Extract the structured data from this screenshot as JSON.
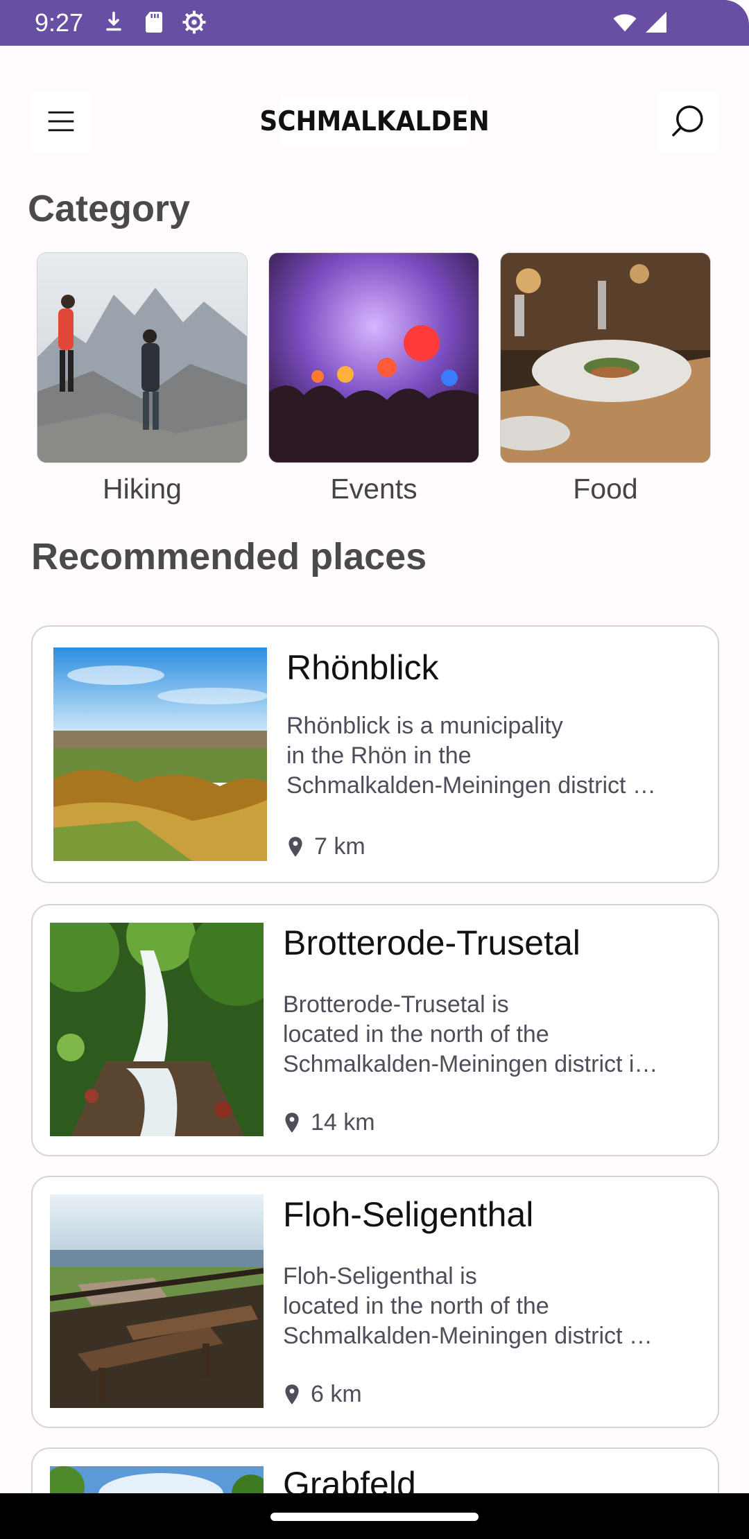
{
  "status_bar": {
    "time": "9:27",
    "icons": [
      "download-icon",
      "sd-card-icon",
      "settings-gear-icon",
      "wifi-icon",
      "cell-signal-icon"
    ]
  },
  "header": {
    "logo_text": "SCHMALKALDEN",
    "menu_icon": "hamburger-menu-icon",
    "search_icon": "search-icon"
  },
  "category": {
    "title": "Category",
    "items": [
      {
        "label": "Hiking"
      },
      {
        "label": "Events"
      },
      {
        "label": "Food"
      }
    ]
  },
  "recommended": {
    "title": "Recommended places",
    "places": [
      {
        "name": "Rhönblick",
        "desc_lines": [
          "Rhönblick is a municipality",
          "in the Rhön in the",
          "Schmalkalden-Meiningen district …"
        ],
        "distance": "7 km"
      },
      {
        "name": "Brotterode-Trusetal",
        "desc_lines": [
          "Brotterode-Trusetal is",
          "located in the north of the",
          "Schmalkalden-Meiningen district i…"
        ],
        "distance": "14 km"
      },
      {
        "name": "Floh-Seligenthal",
        "desc_lines": [
          "Floh-Seligenthal is",
          "located in the north of the",
          "Schmalkalden-Meiningen district …"
        ],
        "distance": "6 km"
      },
      {
        "name": "Grabfeld"
      }
    ]
  },
  "colors": {
    "status_bar": "#6750a4",
    "background": "#fffbfe",
    "card_border": "#d4d4d4"
  }
}
